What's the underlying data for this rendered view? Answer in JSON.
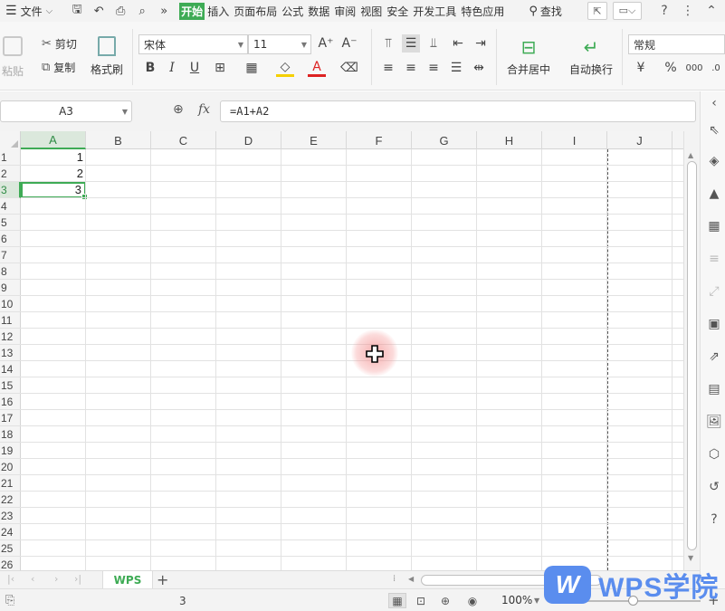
{
  "menubar": {
    "file_label": "文件",
    "tabs": [
      {
        "label": "开始",
        "active": true
      },
      {
        "label": "插入",
        "active": false
      },
      {
        "label": "页面布局",
        "active": false
      },
      {
        "label": "公式",
        "active": false
      },
      {
        "label": "数据",
        "active": false
      },
      {
        "label": "审阅",
        "active": false
      },
      {
        "label": "视图",
        "active": false
      },
      {
        "label": "安全",
        "active": false
      },
      {
        "label": "开发工具",
        "active": false
      },
      {
        "label": "特色应用",
        "active": false
      }
    ],
    "search_label": "查找"
  },
  "ribbon": {
    "paste_label": "粘贴",
    "cut_label": "剪切",
    "copy_label": "复制",
    "format_painter_label": "格式刷",
    "font_name": "宋体",
    "font_size": "11",
    "merge_label": "合并居中",
    "wrap_label": "自动换行",
    "number_format": "常规"
  },
  "formula_bar": {
    "name_box": "A3",
    "fx_label": "fx",
    "formula": "=A1+A2"
  },
  "sheet": {
    "columns": [
      "A",
      "B",
      "C",
      "D",
      "E",
      "F",
      "G",
      "H",
      "I",
      "J"
    ],
    "rows": [
      "1",
      "2",
      "3",
      "4",
      "5",
      "6",
      "7",
      "8",
      "9",
      "10",
      "11",
      "12",
      "13",
      "14",
      "15",
      "16",
      "17",
      "18",
      "19",
      "20",
      "21",
      "22",
      "23",
      "24",
      "25",
      "26"
    ],
    "selected_column": "A",
    "selected_row": "3",
    "cells": {
      "A1": "1",
      "A2": "2",
      "A3": "3"
    }
  },
  "sheet_tabs": {
    "active_sheet": "WPS",
    "add_label": "+"
  },
  "status_bar": {
    "sum_value": "3",
    "zoom": "100%"
  },
  "watermark": {
    "text": "WPS学院"
  },
  "colors": {
    "accent": "#3eab55",
    "watermark": "#5a8dee"
  }
}
